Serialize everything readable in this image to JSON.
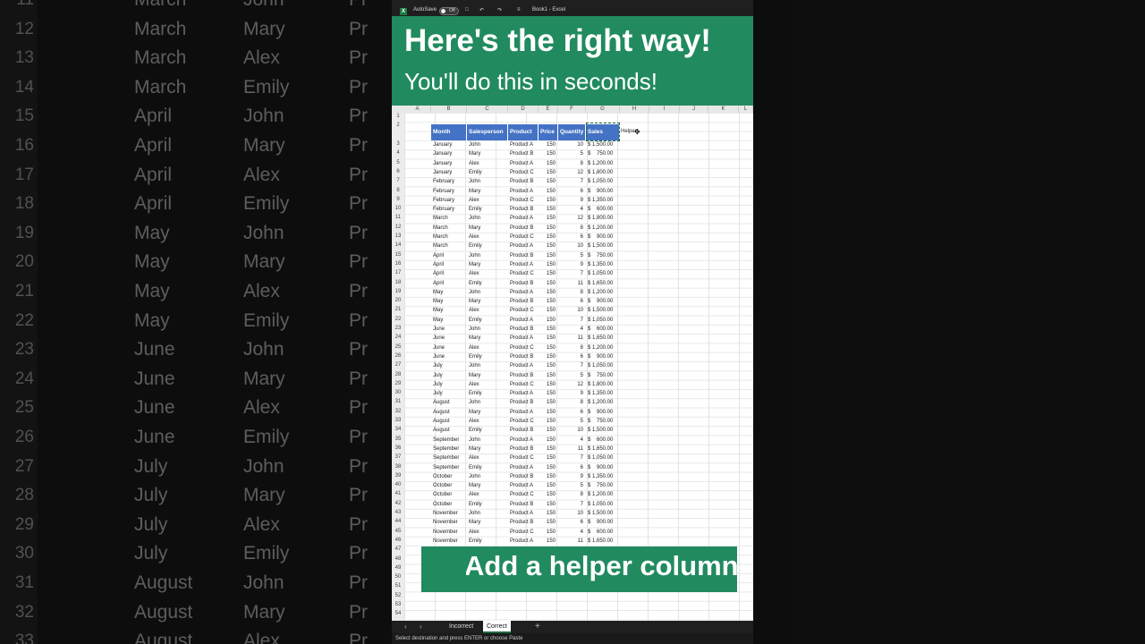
{
  "background": {
    "rows": [
      {
        "num": "11",
        "month": "March",
        "person": "John",
        "prod": "Pr"
      },
      {
        "num": "12",
        "month": "March",
        "person": "Mary",
        "prod": "Pr"
      },
      {
        "num": "13",
        "month": "March",
        "person": "Alex",
        "prod": "Pr"
      },
      {
        "num": "14",
        "month": "March",
        "person": "Emily",
        "prod": "Pr"
      },
      {
        "num": "15",
        "month": "April",
        "person": "John",
        "prod": "Pr"
      },
      {
        "num": "16",
        "month": "April",
        "person": "Mary",
        "prod": "Pr"
      },
      {
        "num": "17",
        "month": "April",
        "person": "Alex",
        "prod": "Pr"
      },
      {
        "num": "18",
        "month": "April",
        "person": "Emily",
        "prod": "Pr"
      },
      {
        "num": "19",
        "month": "May",
        "person": "John",
        "prod": "Pr"
      },
      {
        "num": "20",
        "month": "May",
        "person": "Mary",
        "prod": "Pr"
      },
      {
        "num": "21",
        "month": "May",
        "person": "Alex",
        "prod": "Pr"
      },
      {
        "num": "22",
        "month": "May",
        "person": "Emily",
        "prod": "Pr"
      },
      {
        "num": "23",
        "month": "June",
        "person": "John",
        "prod": "Pr"
      },
      {
        "num": "24",
        "month": "June",
        "person": "Mary",
        "prod": "Pr"
      },
      {
        "num": "25",
        "month": "June",
        "person": "Alex",
        "prod": "Pr"
      },
      {
        "num": "26",
        "month": "June",
        "person": "Emily",
        "prod": "Pr"
      },
      {
        "num": "27",
        "month": "July",
        "person": "John",
        "prod": "Pr"
      },
      {
        "num": "28",
        "month": "July",
        "person": "Mary",
        "prod": "Pr"
      },
      {
        "num": "29",
        "month": "July",
        "person": "Alex",
        "prod": "Pr"
      },
      {
        "num": "30",
        "month": "July",
        "person": "Emily",
        "prod": "Pr"
      },
      {
        "num": "31",
        "month": "August",
        "person": "John",
        "prod": "Pr"
      },
      {
        "num": "32",
        "month": "August",
        "person": "Mary",
        "prod": "Pr"
      },
      {
        "num": "33",
        "month": "August",
        "person": "Alex",
        "prod": "Pr"
      }
    ]
  },
  "titlebar": {
    "autosave": "AutoSave",
    "toggle": "Off",
    "filename": "Book1 - Excel"
  },
  "caption_top": {
    "line1": "Here's the right way!",
    "line2": "You'll do this in seconds!"
  },
  "caption_bottom": {
    "text": "Add a helper column"
  },
  "sheet": {
    "columns": [
      "A",
      "B",
      "C",
      "D",
      "E",
      "F",
      "G",
      "H",
      "I",
      "J",
      "K",
      "L"
    ],
    "headers": [
      "Month",
      "Salesperson",
      "Product",
      "Price",
      "Quantity",
      "Sales"
    ],
    "helper_label": "Helper",
    "rows": [
      [
        "January",
        "John",
        "Product A",
        "150",
        "10",
        "$ 1,500.00"
      ],
      [
        "January",
        "Mary",
        "Product B",
        "150",
        "5",
        "$    750.00"
      ],
      [
        "January",
        "Alex",
        "Product A",
        "150",
        "8",
        "$ 1,200.00"
      ],
      [
        "January",
        "Emily",
        "Product C",
        "150",
        "12",
        "$ 1,800.00"
      ],
      [
        "February",
        "John",
        "Product B",
        "150",
        "7",
        "$ 1,050.00"
      ],
      [
        "February",
        "Mary",
        "Product A",
        "150",
        "6",
        "$    900.00"
      ],
      [
        "February",
        "Alex",
        "Product C",
        "150",
        "9",
        "$ 1,350.00"
      ],
      [
        "February",
        "Emily",
        "Product B",
        "150",
        "4",
        "$    600.00"
      ],
      [
        "March",
        "John",
        "Product A",
        "150",
        "12",
        "$ 1,800.00"
      ],
      [
        "March",
        "Mary",
        "Product B",
        "150",
        "8",
        "$ 1,200.00"
      ],
      [
        "March",
        "Alex",
        "Product C",
        "150",
        "6",
        "$    900.00"
      ],
      [
        "March",
        "Emily",
        "Product A",
        "150",
        "10",
        "$ 1,500.00"
      ],
      [
        "April",
        "John",
        "Product B",
        "150",
        "5",
        "$    750.00"
      ],
      [
        "April",
        "Mary",
        "Product A",
        "150",
        "9",
        "$ 1,350.00"
      ],
      [
        "April",
        "Alex",
        "Product C",
        "150",
        "7",
        "$ 1,050.00"
      ],
      [
        "April",
        "Emily",
        "Product B",
        "150",
        "11",
        "$ 1,650.00"
      ],
      [
        "May",
        "John",
        "Product A",
        "150",
        "8",
        "$ 1,200.00"
      ],
      [
        "May",
        "Mary",
        "Product B",
        "150",
        "6",
        "$    900.00"
      ],
      [
        "May",
        "Alex",
        "Product C",
        "150",
        "10",
        "$ 1,500.00"
      ],
      [
        "May",
        "Emily",
        "Product A",
        "150",
        "7",
        "$ 1,050.00"
      ],
      [
        "June",
        "John",
        "Product B",
        "150",
        "4",
        "$    600.00"
      ],
      [
        "June",
        "Mary",
        "Product A",
        "150",
        "11",
        "$ 1,650.00"
      ],
      [
        "June",
        "Alex",
        "Product C",
        "150",
        "8",
        "$ 1,200.00"
      ],
      [
        "June",
        "Emily",
        "Product B",
        "150",
        "6",
        "$    900.00"
      ],
      [
        "July",
        "John",
        "Product A",
        "150",
        "7",
        "$ 1,050.00"
      ],
      [
        "July",
        "Mary",
        "Product B",
        "150",
        "5",
        "$    750.00"
      ],
      [
        "July",
        "Alex",
        "Product C",
        "150",
        "12",
        "$ 1,800.00"
      ],
      [
        "July",
        "Emily",
        "Product A",
        "150",
        "9",
        "$ 1,350.00"
      ],
      [
        "August",
        "John",
        "Product B",
        "150",
        "8",
        "$ 1,200.00"
      ],
      [
        "August",
        "Mary",
        "Product A",
        "150",
        "6",
        "$    900.00"
      ],
      [
        "August",
        "Alex",
        "Product C",
        "150",
        "5",
        "$    750.00"
      ],
      [
        "August",
        "Emily",
        "Product B",
        "150",
        "10",
        "$ 1,500.00"
      ],
      [
        "September",
        "John",
        "Product A",
        "150",
        "4",
        "$    600.00"
      ],
      [
        "September",
        "Mary",
        "Product B",
        "150",
        "11",
        "$ 1,650.00"
      ],
      [
        "September",
        "Alex",
        "Product C",
        "150",
        "7",
        "$ 1,050.00"
      ],
      [
        "September",
        "Emily",
        "Product A",
        "150",
        "6",
        "$    900.00"
      ],
      [
        "October",
        "John",
        "Product B",
        "150",
        "9",
        "$ 1,350.00"
      ],
      [
        "October",
        "Mary",
        "Product A",
        "150",
        "5",
        "$    750.00"
      ],
      [
        "October",
        "Alex",
        "Product C",
        "150",
        "8",
        "$ 1,200.00"
      ],
      [
        "October",
        "Emily",
        "Product B",
        "150",
        "7",
        "$ 1,050.00"
      ],
      [
        "November",
        "John",
        "Product A",
        "150",
        "10",
        "$ 1,500.00"
      ],
      [
        "November",
        "Mary",
        "Product B",
        "150",
        "6",
        "$    900.00"
      ],
      [
        "November",
        "Alex",
        "Product C",
        "150",
        "4",
        "$    600.00"
      ],
      [
        "November",
        "Emily",
        "Product A",
        "150",
        "11",
        "$ 1,650.00"
      ]
    ]
  },
  "tabs": {
    "incorrect": "Incorrect",
    "correct": "Correct",
    "add": "+"
  },
  "status": {
    "text": "Select destination and press ENTER or choose Paste"
  },
  "colors": {
    "accent_green": "#218a5f",
    "header_blue": "#4472c4"
  }
}
